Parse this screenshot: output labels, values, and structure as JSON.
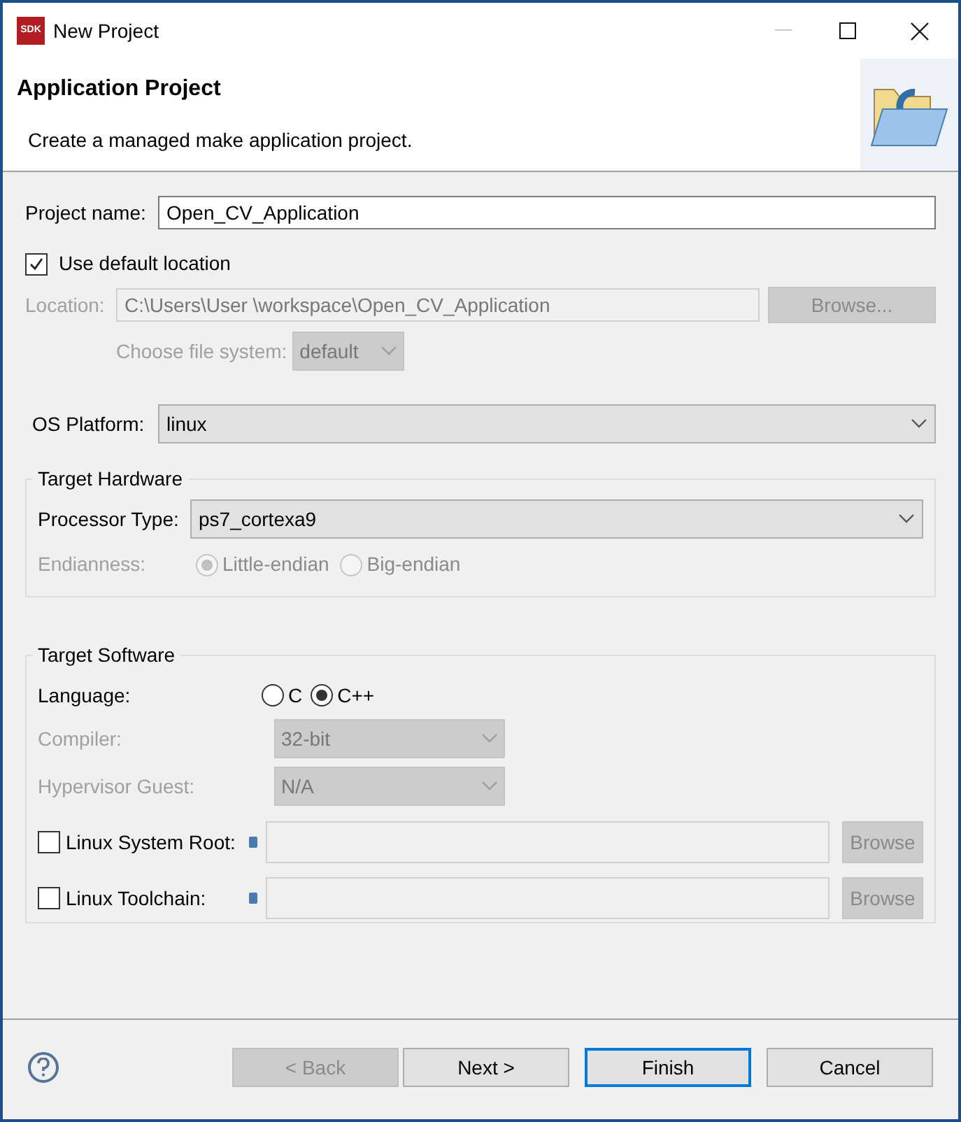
{
  "window": {
    "title": "New Project",
    "icon_text": "SDK"
  },
  "header": {
    "title": "Application Project",
    "description": "Create a managed make application project."
  },
  "project_name": {
    "label": "Project name:",
    "value": "Open_CV_Application"
  },
  "use_default_location": {
    "label": "Use default location",
    "checked": true
  },
  "location": {
    "label": "Location:",
    "value": "C:\\Users\\User \\workspace\\Open_CV_Application",
    "disabled": true,
    "button": "Browse..."
  },
  "file_system": {
    "label": "Choose file system:",
    "value": "default",
    "disabled": true
  },
  "os_platform": {
    "label": "OS Platform:",
    "value": "linux"
  },
  "target_hardware": {
    "title": "Target Hardware",
    "processor_type": {
      "label": "Processor Type:",
      "value": "ps7_cortexa9"
    },
    "endianness": {
      "label": "Endianness:",
      "disabled": true,
      "options": [
        {
          "label": "Little-endian",
          "selected": true
        },
        {
          "label": "Big-endian",
          "selected": false
        }
      ]
    }
  },
  "target_software": {
    "title": "Target Software",
    "language": {
      "label": "Language:",
      "options": [
        {
          "label": "C",
          "selected": false
        },
        {
          "label": "C++",
          "selected": true
        }
      ]
    },
    "rows": [
      {
        "kind": "select",
        "label": "Compiler:",
        "value": "32-bit",
        "disabled": true
      },
      {
        "kind": "select",
        "label": "Hypervisor Guest:",
        "value": "N/A",
        "disabled": true
      },
      {
        "kind": "path",
        "label": "Linux System Root:",
        "checked": false,
        "button": "Browse",
        "disabled": true
      },
      {
        "kind": "path",
        "label": "Linux Toolchain:",
        "checked": false,
        "button": "Browse",
        "disabled": true
      }
    ]
  },
  "buttons": [
    {
      "label": "< Back",
      "disabled": true,
      "default": false
    },
    {
      "label": "Next >",
      "disabled": false,
      "default": false
    },
    {
      "label": "Finish",
      "disabled": false,
      "default": true
    },
    {
      "label": "Cancel",
      "disabled": false,
      "default": false
    }
  ]
}
